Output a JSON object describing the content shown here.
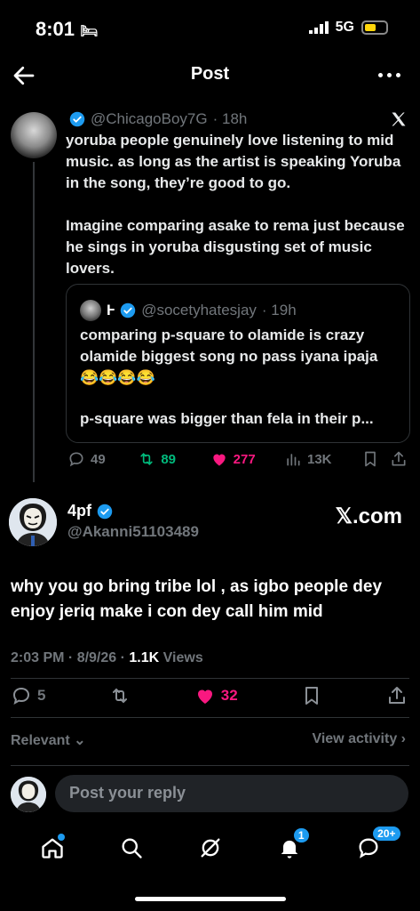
{
  "status_bar": {
    "time": "8:01",
    "network": "5G"
  },
  "header": {
    "title": "Post"
  },
  "quoted_post": {
    "handle": "@ChicagoBoy7G",
    "time": "· 18h",
    "text": "yoruba people genuinely love listening to mid music. as long as the artist is speaking Yoruba in the song, they’re good to go.\n\nImagine comparing asake to rema just because he sings in yoruba  disgusting set of music lovers.",
    "inner_quote": {
      "name": "Ⱶ",
      "handle": "@socetyhatesjay",
      "time": "· 19h",
      "text": "comparing p-square to olamide is crazy olamide biggest song no pass iyana ipaja 😂😂😂😂",
      "text2": "p-square was bigger than fela in their p..."
    },
    "actions": {
      "replies": "49",
      "reposts": "89",
      "likes": "277",
      "views": "13K"
    }
  },
  "main_post": {
    "name": "4pf",
    "handle": "@Akanni51103489",
    "xcom_label": "𝕏.com",
    "text": "why you go bring tribe lol , as igbo people dey enjoy jeriq make i con dey call him mid",
    "timestamp": "2:03 PM · 8/9/26 ·",
    "views_count": "1.1K",
    "views_label": "Views",
    "actions": {
      "replies": "5",
      "likes": "32"
    },
    "relevant_label": "Relevant",
    "view_activity_label": "View activity"
  },
  "reply_bar": {
    "placeholder": "Post your reply"
  },
  "bottom_nav": {
    "notifications_badge": "1",
    "messages_badge": "20+"
  },
  "colors": {
    "accent": "#1d9bf0",
    "like": "#f91880",
    "repost": "#00ba7c",
    "muted": "#71767b"
  }
}
